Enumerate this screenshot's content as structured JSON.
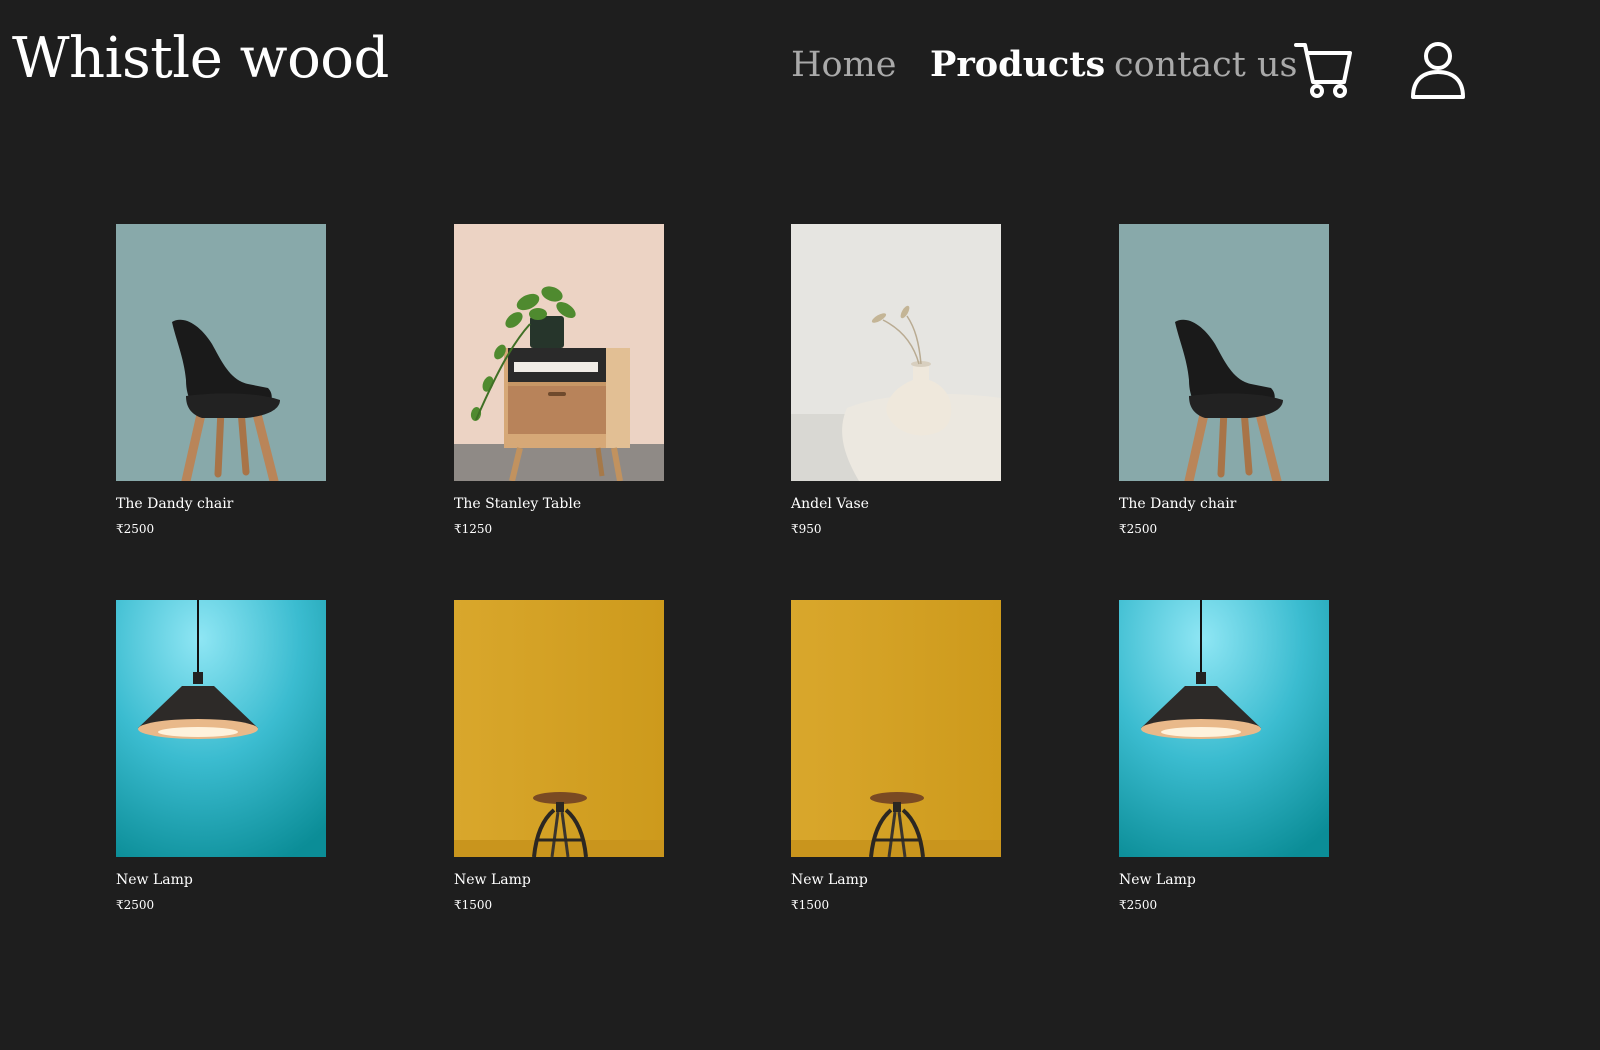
{
  "header": {
    "brand": "Whistle wood",
    "nav": [
      {
        "label": "Home",
        "active": false
      },
      {
        "label": "Products",
        "active": true
      },
      {
        "label": "contact us",
        "active": false
      }
    ],
    "icons": [
      "cart-icon",
      "user-icon"
    ]
  },
  "products": [
    {
      "name": "The Dandy chair",
      "price": "₹2500",
      "image": "black-chair",
      "bg": "#88a9aa"
    },
    {
      "name": "The Stanley Table",
      "price": "₹1250",
      "image": "bedside-table",
      "bg": "#ecd3c4"
    },
    {
      "name": "Andel Vase",
      "price": "₹950",
      "image": "vase",
      "bg": "#e6e5e1"
    },
    {
      "name": "The Dandy chair",
      "price": "₹2500",
      "image": "black-chair",
      "bg": "#88a9aa"
    },
    {
      "name": "New Lamp",
      "price": "₹2500",
      "image": "pendant-lamp",
      "bg": "#3bbcd0"
    },
    {
      "name": "New Lamp",
      "price": "₹1500",
      "image": "stool",
      "bg": "#d6a52c"
    },
    {
      "name": "New Lamp",
      "price": "₹1500",
      "image": "stool",
      "bg": "#d6a52c"
    },
    {
      "name": "New Lamp",
      "price": "₹2500",
      "image": "pendant-lamp",
      "bg": "#3bbcd0"
    }
  ],
  "colors": {
    "background": "#1e1e1e",
    "nav_inactive": "#a9a9a9",
    "text": "#ffffff"
  }
}
